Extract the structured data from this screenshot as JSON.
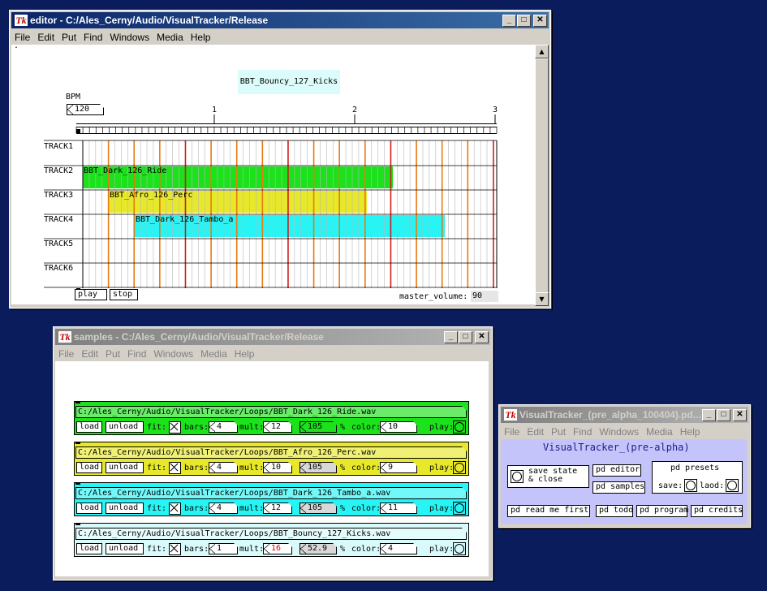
{
  "editor_window": {
    "title": "editor  - C:/Ales_Cerny/Audio/VisualTracker/Release",
    "menu": [
      "File",
      "Edit",
      "Put",
      "Find",
      "Windows",
      "Media",
      "Help"
    ],
    "dot": ".",
    "song_name": "BBT_Bouncy_127_Kicks",
    "bpm_label": "BPM",
    "bpm_value": "120",
    "ruler_numbers": [
      "1",
      "2",
      "3"
    ],
    "tracks": [
      {
        "label": "TRACK1",
        "clip": "",
        "color": ""
      },
      {
        "label": "TRACK2",
        "clip": "BBT_Dark_126_Ride",
        "color": "#1be21b"
      },
      {
        "label": "TRACK3",
        "clip": "BBT_Afro_126_Perc",
        "color": "#e8e82a"
      },
      {
        "label": "TRACK4",
        "clip": "BBT_Dark_126_Tambo_a",
        "color": "#27f4f4"
      },
      {
        "label": "TRACK5",
        "clip": "",
        "color": ""
      },
      {
        "label": "TRACK6",
        "clip": "",
        "color": ""
      }
    ],
    "play_label": "play",
    "stop_label": "stop",
    "master_volume_label": "master_volume:",
    "master_volume_value": "90"
  },
  "samples_window": {
    "title": "samples  - C:/Ales_Cerny/Audio/VisualTracker/Release",
    "menu": [
      "File",
      "Edit",
      "Put",
      "Find",
      "Windows",
      "Media",
      "Help"
    ],
    "rows": [
      {
        "path": "C:/Ales_Cerny/Audio/VisualTracker/Loops/BBT_Dark_126_Ride.wav",
        "bars": "4",
        "mult": "12",
        "tempo": "105",
        "color": "10",
        "bg": "#1be21b",
        "mult_red": false
      },
      {
        "path": "C:/Ales_Cerny/Audio/VisualTracker/Loops/BBT_Afro_126_Perc.wav",
        "bars": "4",
        "mult": "10",
        "tempo": "105",
        "color": "9",
        "bg": "#e8e82a",
        "mult_red": false
      },
      {
        "path": "C:/Ales_Cerny/Audio/VisualTracker/Loops/BBT_Dark_126_Tambo_a.wav",
        "bars": "4",
        "mult": "12",
        "tempo": "105",
        "color": "11",
        "bg": "#27f4f4",
        "mult_red": false
      },
      {
        "path": "C:/Ales_Cerny/Audio/VisualTracker/Loops/BBT_Bouncy_127_Kicks.wav",
        "bars": "1",
        "mult": "16",
        "tempo": "52.9",
        "color": "4",
        "bg": "#d8fafa",
        "mult_red": true
      }
    ],
    "load_label": "load",
    "unload_label": "unload",
    "fit_label": "fit:",
    "bars_label": "bars:",
    "mult_label": "mult:",
    "percent_label": "%",
    "color_label": "color:",
    "play_label": "play:"
  },
  "vt_window": {
    "title": "VisualTracker_(pre_alpha_100404).pd...",
    "menu": [
      "File",
      "Edit",
      "Put",
      "Find",
      "Windows",
      "Media",
      "Help"
    ],
    "heading": "VisualTracker_(pre-alpha)",
    "save_state": "save state",
    "and_close": "& close",
    "pd_editor": "pd editor",
    "pd_samples": "pd samples",
    "pd_presets": "pd presets",
    "save_label": "save:",
    "laod_label": "laod:",
    "pd_read_me_first": "pd read me first",
    "pd_todo": "pd todo",
    "pd_program": "pd program",
    "pd_credits": "pd credits"
  }
}
